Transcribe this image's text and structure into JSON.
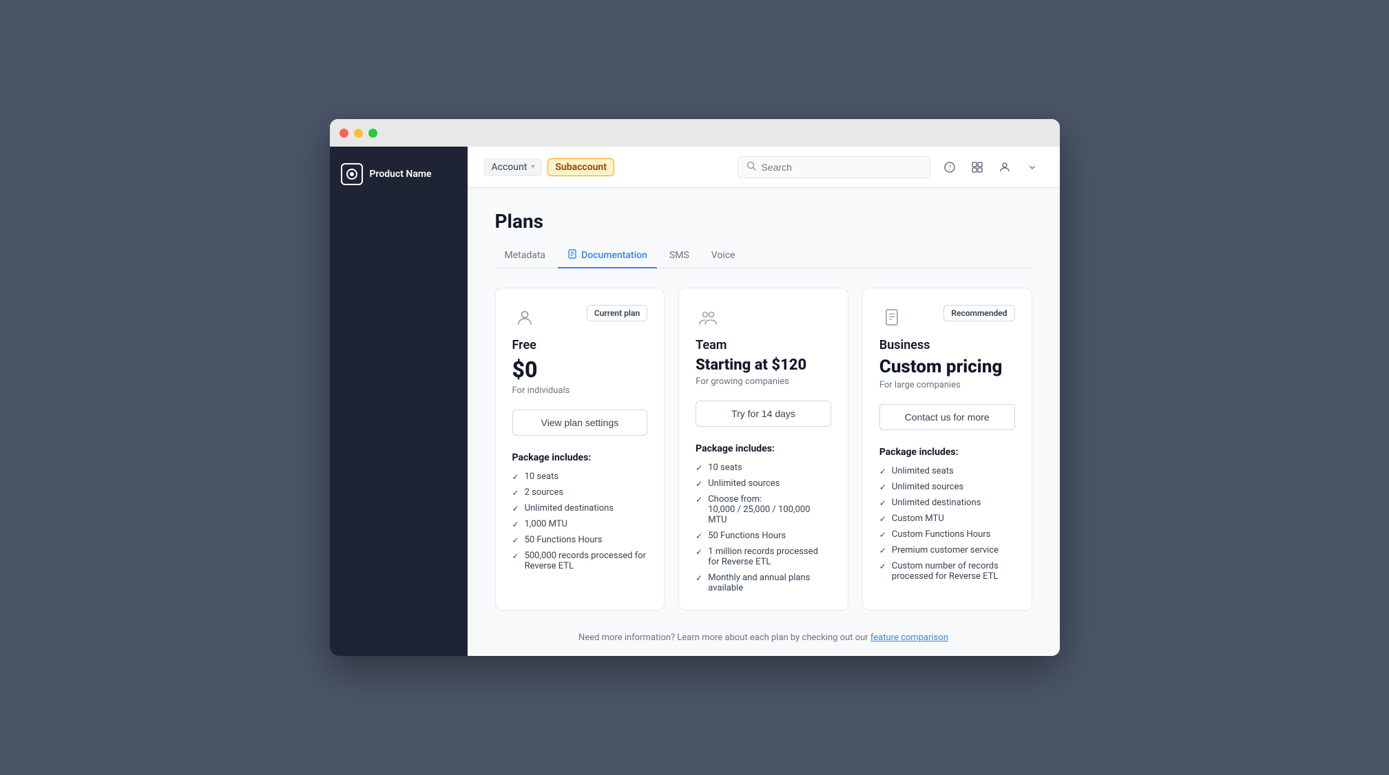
{
  "window": {
    "titlebar": {
      "dots": [
        "red",
        "yellow",
        "green"
      ]
    }
  },
  "sidebar": {
    "logo_icon": "◉",
    "product_name": "Product Name"
  },
  "topbar": {
    "breadcrumb_account": "Account",
    "breadcrumb_chevron": "▾",
    "breadcrumb_subaccount": "Subaccount",
    "search_placeholder": "Search",
    "icon_help": "?",
    "icon_grid": "⊞",
    "icon_user": "👤",
    "icon_chevron": "▾"
  },
  "page": {
    "title": "Plans",
    "tabs": [
      {
        "label": "Metadata",
        "active": false,
        "icon": ""
      },
      {
        "label": "Documentation",
        "active": true,
        "icon": "📄"
      },
      {
        "label": "SMS",
        "active": false,
        "icon": ""
      },
      {
        "label": "Voice",
        "active": false,
        "icon": ""
      }
    ]
  },
  "plans": [
    {
      "id": "free",
      "icon": "👤",
      "badge": "Current plan",
      "name": "Free",
      "price": "$0",
      "desc": "For individuals",
      "btn_label": "View plan settings",
      "package_title": "Package includes:",
      "features": [
        "10 seats",
        "2 sources",
        "Unlimited destinations",
        "1,000 MTU",
        "50 Functions Hours",
        "500,000 records processed for Reverse ETL"
      ]
    },
    {
      "id": "team",
      "icon": "👥",
      "badge": "",
      "name": "Team",
      "price": "Starting at $120",
      "desc": "For growing companies",
      "btn_label": "Try for 14 days",
      "package_title": "Package includes:",
      "features": [
        "10 seats",
        "Unlimited sources",
        "Choose from: 10,000 / 25,000 / 100,000 MTU",
        "50 Functions Hours",
        "1 million records processed for Reverse ETL",
        "Monthly and annual plans available"
      ]
    },
    {
      "id": "business",
      "icon": "📱",
      "badge": "Recommended",
      "name": "Business",
      "price": "Custom pricing",
      "desc": "For large companies",
      "btn_label": "Contact us for more",
      "package_title": "Package includes:",
      "features": [
        "Unlimited seats",
        "Unlimited sources",
        "Unlimited destinations",
        "Custom MTU",
        "Custom Functions Hours",
        "Premium customer service",
        "Custom number of records processed for Reverse ETL"
      ]
    }
  ],
  "footer": {
    "note": "Need more information? Learn more about each plan by checking out our",
    "link_text": "feature comparison"
  }
}
